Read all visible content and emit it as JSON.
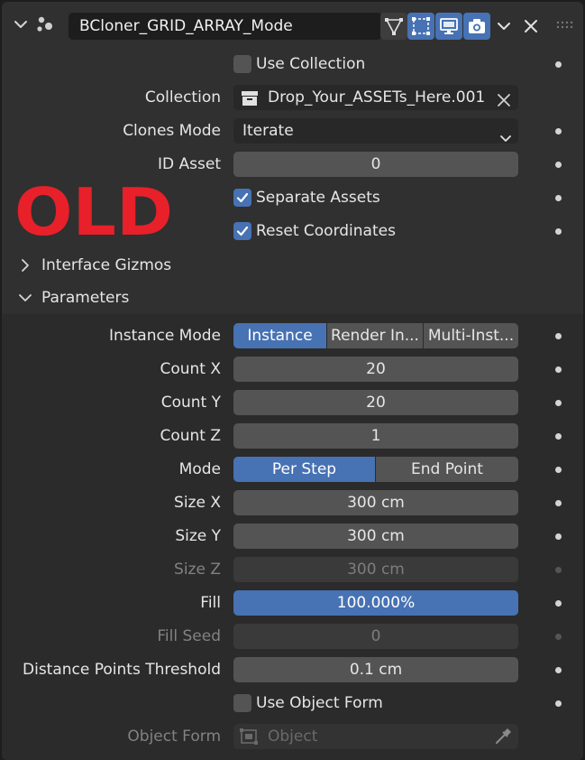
{
  "header": {
    "modifier_name": "BCloner_GRID_ARRAY_Mode",
    "toggles": [
      "edit-mode-toggle",
      "on-cage-toggle",
      "viewport-toggle",
      "render-toggle"
    ]
  },
  "fields": {
    "use_collection": {
      "label": "Use Collection",
      "checked": false
    },
    "collection": {
      "label": "Collection",
      "value": "Drop_Your_ASSETs_Here.001"
    },
    "clones_mode": {
      "label": "Clones Mode",
      "value": "Iterate"
    },
    "id_asset": {
      "label": "ID Asset",
      "value": "0"
    },
    "separate_assets": {
      "label": "Separate Assets",
      "checked": true
    },
    "reset_coordinates": {
      "label": "Reset Coordinates",
      "checked": true
    }
  },
  "stamp": "OLD",
  "sections": {
    "interface_gizmos": "Interface Gizmos",
    "parameters": "Parameters"
  },
  "parameters": {
    "instance_mode": {
      "label": "Instance Mode",
      "options": [
        "Instance",
        "Render In...",
        "Multi-Inst..."
      ],
      "selected": "Instance"
    },
    "count_x": {
      "label": "Count X",
      "value": "20"
    },
    "count_y": {
      "label": "Count Y",
      "value": "20"
    },
    "count_z": {
      "label": "Count Z",
      "value": "1"
    },
    "mode": {
      "label": "Mode",
      "options": [
        "Per Step",
        "End Point"
      ],
      "selected": "Per Step"
    },
    "size_x": {
      "label": "Size X",
      "value": "300 cm"
    },
    "size_y": {
      "label": "Size Y",
      "value": "300 cm"
    },
    "size_z": {
      "label": "Size Z",
      "value": "300 cm",
      "disabled": true
    },
    "fill": {
      "label": "Fill",
      "value": "100.000%",
      "fraction": 1.0
    },
    "fill_seed": {
      "label": "Fill Seed",
      "value": "0",
      "disabled": true
    },
    "distance_points_threshold": {
      "label": "Distance Points Threshold",
      "value": "0.1 cm"
    },
    "use_object_form": {
      "label": "Use Object Form",
      "checked": false
    },
    "object_form": {
      "label": "Object Form",
      "placeholder": "Object",
      "disabled": true
    }
  },
  "colors": {
    "accent": "#4772b3",
    "panel": "#303030",
    "field": "#545454",
    "stamp": "#e8202a"
  }
}
